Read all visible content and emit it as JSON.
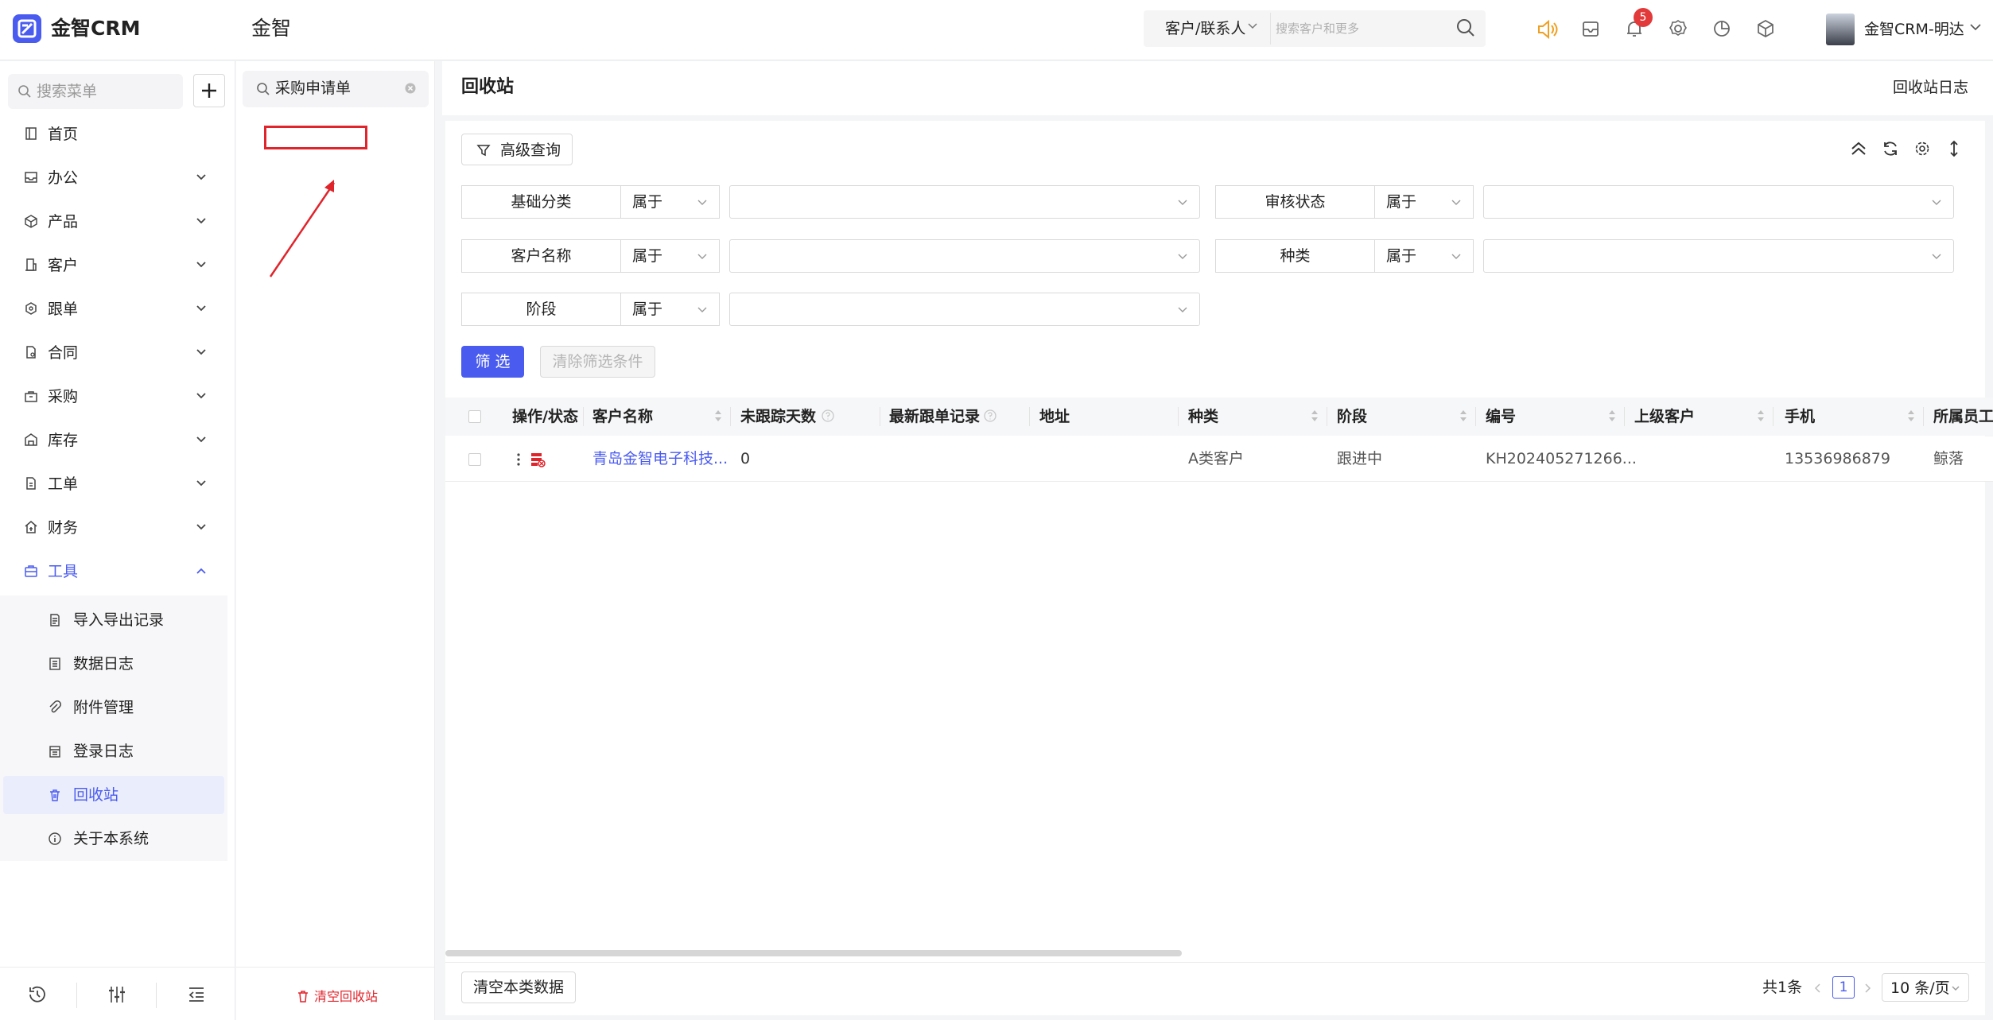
{
  "app": {
    "name": "金智CRM",
    "company": "金智"
  },
  "topbar": {
    "search_type": "客户/联系人",
    "search_placeholder": "搜索客户和更多",
    "notification_count": "5",
    "user_name": "金智CRM-明达",
    "accent_color": "#4a5bf0"
  },
  "sidebar": {
    "search_placeholder": "搜索菜单",
    "items": [
      {
        "label": "首页",
        "icon": "book-icon"
      },
      {
        "label": "办公",
        "icon": "inbox-icon"
      },
      {
        "label": "产品",
        "icon": "cube-icon"
      },
      {
        "label": "客户",
        "icon": "building-icon"
      },
      {
        "label": "跟单",
        "icon": "hexagon-icon"
      },
      {
        "label": "合同",
        "icon": "contract-icon"
      },
      {
        "label": "采购",
        "icon": "bag-icon"
      },
      {
        "label": "库存",
        "icon": "warehouse-icon"
      },
      {
        "label": "工单",
        "icon": "ticket-icon"
      },
      {
        "label": "财务",
        "icon": "finance-icon"
      },
      {
        "label": "工具",
        "icon": "toolbox-icon"
      }
    ],
    "tools_sub": [
      {
        "label": "导入导出记录",
        "icon": "import-export-icon"
      },
      {
        "label": "数据日志",
        "icon": "log-icon"
      },
      {
        "label": "附件管理",
        "icon": "paperclip-icon"
      },
      {
        "label": "登录日志",
        "icon": "calendar-icon"
      },
      {
        "label": "回收站",
        "icon": "trash-icon"
      },
      {
        "label": "关于本系统",
        "icon": "info-icon"
      }
    ]
  },
  "mid_panel": {
    "search_value": "采购申请单",
    "empty_recycle_label": "清空回收站"
  },
  "main": {
    "title": "回收站",
    "log_link": "回收站日志",
    "advanced_query": "高级查询",
    "filters": [
      {
        "label": "基础分类",
        "op": "属于",
        "value": ""
      },
      {
        "label": "审核状态",
        "op": "属于",
        "value": ""
      },
      {
        "label": "客户名称",
        "op": "属于",
        "value": ""
      },
      {
        "label": "种类",
        "op": "属于",
        "value": ""
      },
      {
        "label": "阶段",
        "op": "属于",
        "value": ""
      }
    ],
    "filter_button": "筛 选",
    "clear_filter_button": "清除筛选条件",
    "columns": [
      "操作/状态",
      "客户名称",
      "未跟踪天数",
      "最新跟单记录",
      "地址",
      "种类",
      "阶段",
      "编号",
      "上级客户",
      "手机",
      "所属员工"
    ],
    "rows": [
      {
        "name": "青岛金智电子科技...",
        "days": "0",
        "latest": "",
        "address": "",
        "kind": "A类客户",
        "stage": "跟进中",
        "code": "KH202405271266...",
        "parent": "",
        "phone": "13536986879",
        "owner": "鲸落"
      }
    ],
    "clear_data_button": "清空本类数据",
    "pagination": {
      "total": "共1条",
      "current": "1",
      "page_size": "10 条/页"
    }
  }
}
